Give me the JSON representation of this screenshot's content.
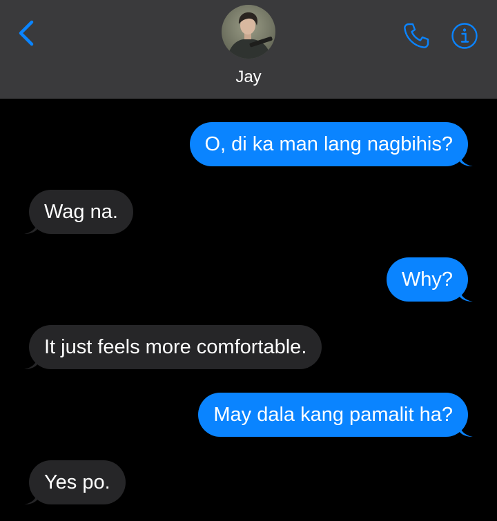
{
  "header": {
    "contact_name": "Jay",
    "back_icon": "chevron-left-icon",
    "call_icon": "phone-icon",
    "info_icon": "info-icon"
  },
  "colors": {
    "accent": "#0a84ff",
    "header_bg": "#3a3a3c",
    "sent_bubble": "#0a84ff",
    "received_bubble": "#262628",
    "background": "#000000",
    "text": "#ffffff"
  },
  "messages": [
    {
      "direction": "sent",
      "text": "O, di ka man lang nagbihis?"
    },
    {
      "direction": "received",
      "text": "Wag na."
    },
    {
      "direction": "sent",
      "text": "Why?"
    },
    {
      "direction": "received",
      "text": "It just feels more comfortable."
    },
    {
      "direction": "sent",
      "text": "May dala kang pamalit ha?"
    },
    {
      "direction": "received",
      "text": "Yes po."
    }
  ]
}
